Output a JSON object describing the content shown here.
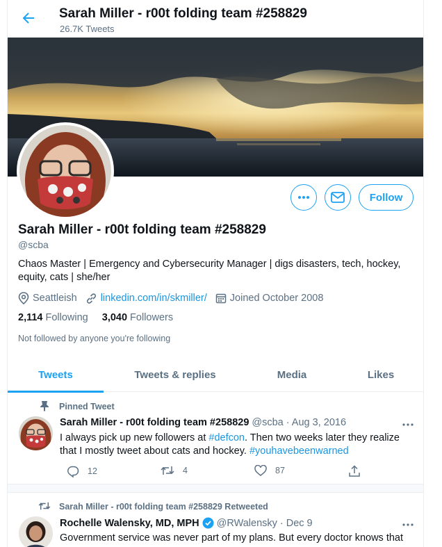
{
  "header": {
    "title": "Sarah Miller - r00t folding team #258829",
    "tweet_count": "26.7K Tweets"
  },
  "profile": {
    "name": "Sarah Miller - r00t folding team #258829",
    "handle": "@scba",
    "bio": "Chaos Master | Emergency and Cybersecurity Manager |  digs disasters, tech, hockey, equity, cats | she/her",
    "location": "Seattleish",
    "website": "linkedin.com/in/skmiller/",
    "joined": "Joined October 2008",
    "following_count": "2,114",
    "following_label": "Following",
    "followers_count": "3,040",
    "followers_label": "Followers",
    "not_followed": "Not followed by anyone you're following",
    "follow_button": "Follow"
  },
  "tabs": [
    {
      "label": "Tweets",
      "active": true
    },
    {
      "label": "Tweets & replies",
      "active": false
    },
    {
      "label": "Media",
      "active": false
    },
    {
      "label": "Likes",
      "active": false
    }
  ],
  "tweets": [
    {
      "context": "Pinned Tweet",
      "author": "Sarah Miller - r00t folding team #258829",
      "handle": "@scba",
      "date": "· Aug 3, 2016",
      "text_1": "I always pick up new followers at ",
      "hashtag_1": "#defcon",
      "text_2": ". Then two weeks later they realize that I mostly tweet about cats and hockey. ",
      "hashtag_2": "#youhavebeenwarned",
      "replies": "12",
      "retweets": "4",
      "likes": "87"
    },
    {
      "context": "Sarah Miller - r00t folding team #258829 Retweeted",
      "author": "Rochelle Walensky, MD, MPH",
      "handle": "@RWalensky",
      "date": "· Dec 9",
      "text": "Government service was never part of my plans. But every doctor knows that"
    }
  ],
  "colors": {
    "accent": "#1da1f2",
    "link": "#1b95e0",
    "muted": "#5b7083"
  },
  "icons": {
    "back": "arrow-left-icon",
    "more": "more-dots-icon",
    "message": "envelope-icon",
    "location": "map-pin-icon",
    "link": "link-icon",
    "calendar": "calendar-icon",
    "pin": "pin-icon",
    "retweet": "retweet-icon",
    "reply": "reply-icon",
    "like": "heart-icon",
    "share": "share-icon",
    "verified": "verified-badge-icon"
  }
}
